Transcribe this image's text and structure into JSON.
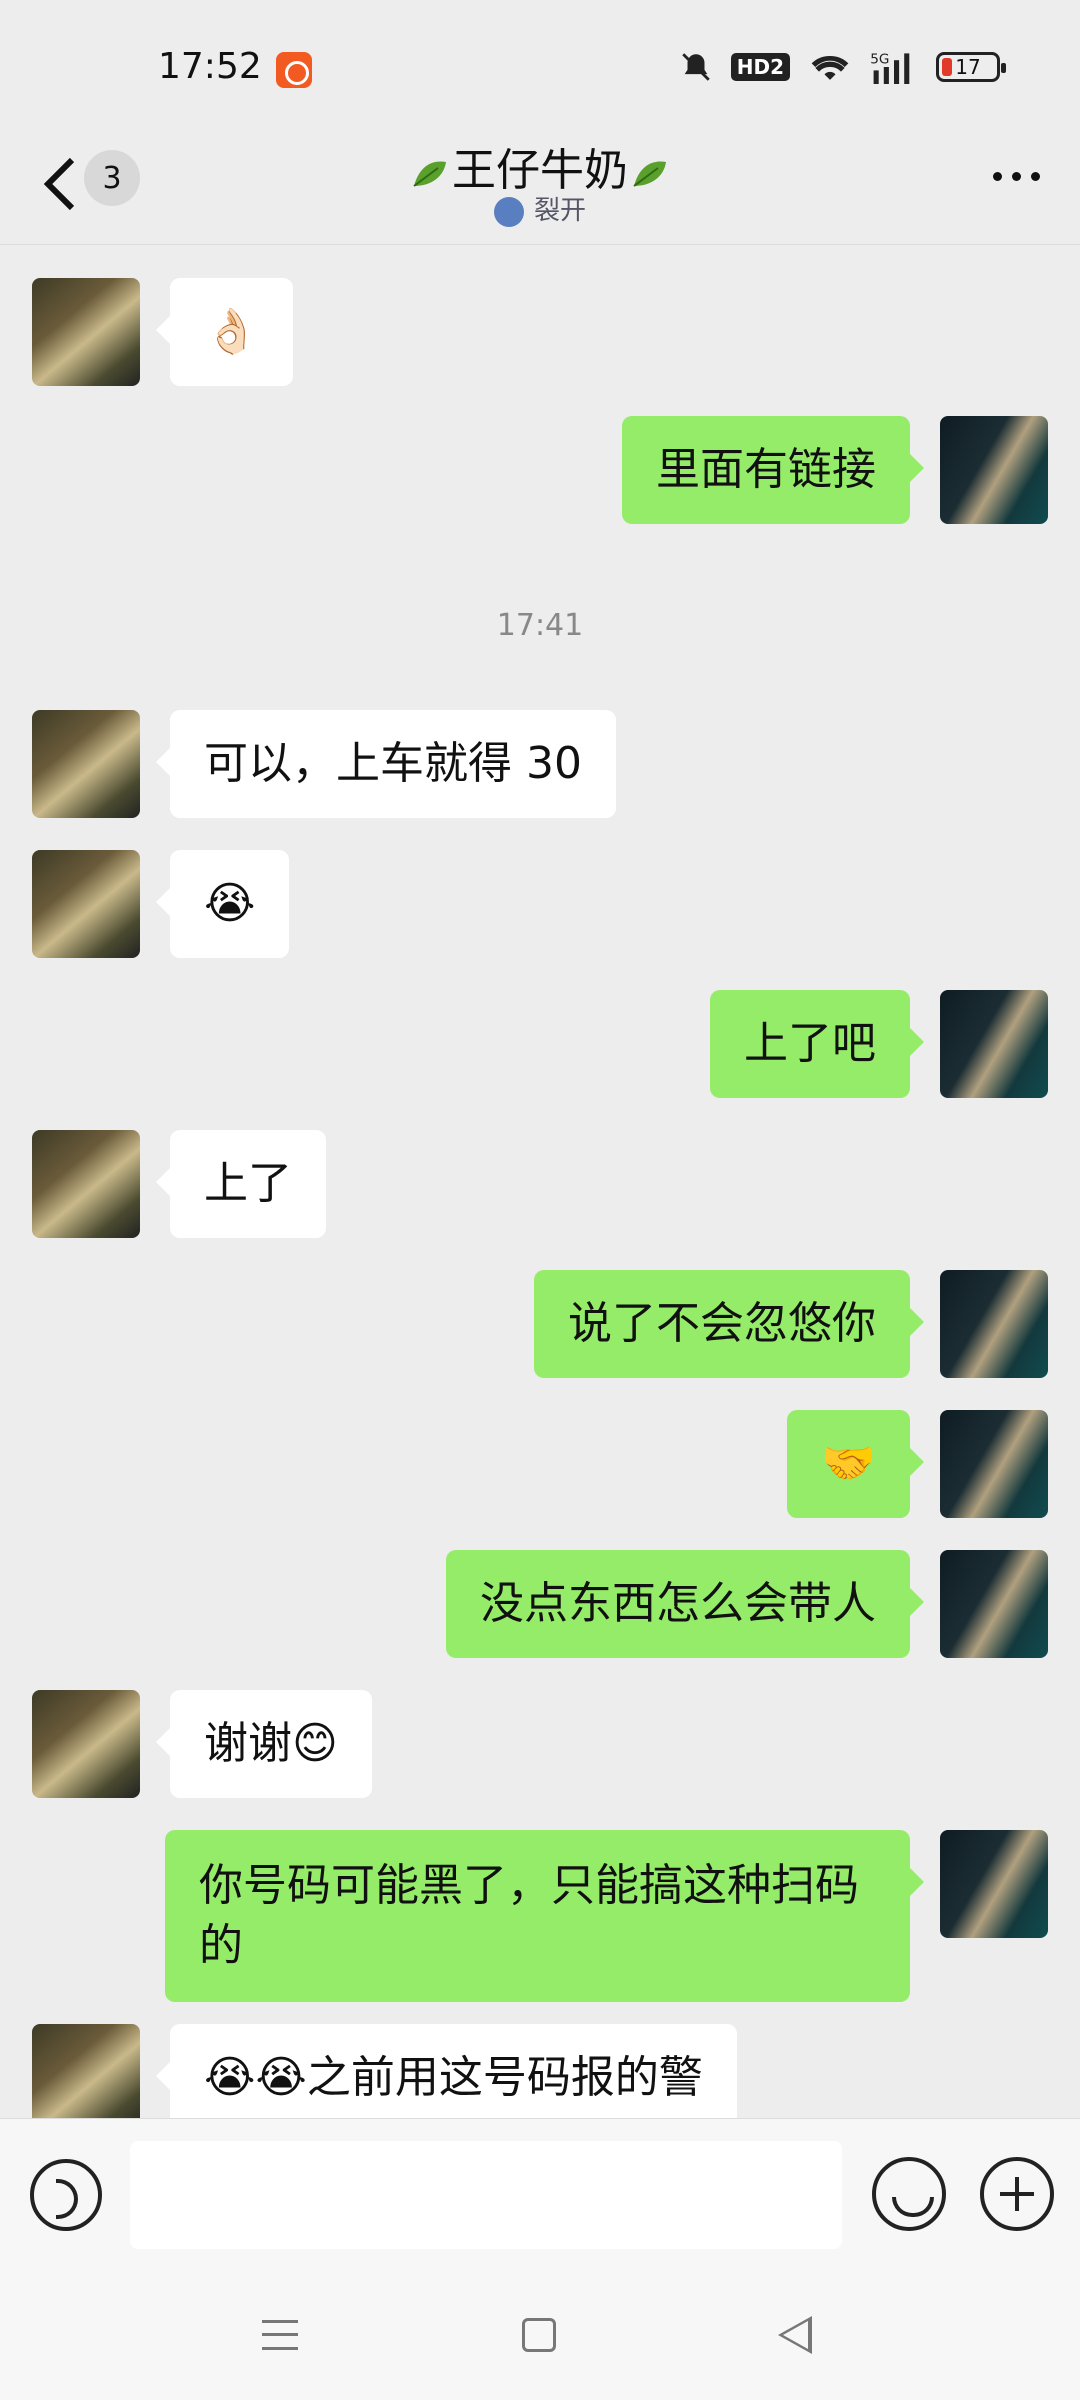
{
  "status": {
    "time": "17:52",
    "battery": "17",
    "hd": "HD2"
  },
  "header": {
    "unread_count": "3",
    "title": "王仔牛奶",
    "subtitle": "裂开"
  },
  "messages": [
    {
      "side": "in",
      "text": "👌🏻"
    },
    {
      "side": "out",
      "text": "里面有链接"
    },
    {
      "timestamp": "17:41"
    },
    {
      "side": "in",
      "text": "可以，上车就得 30"
    },
    {
      "side": "in",
      "text": "😭"
    },
    {
      "side": "out",
      "text": "上了吧"
    },
    {
      "side": "in",
      "text": "上了"
    },
    {
      "side": "out",
      "text": "说了不会忽悠你"
    },
    {
      "side": "out",
      "text": "🤝"
    },
    {
      "side": "out",
      "text": "没点东西怎么会带人"
    },
    {
      "side": "in",
      "text": "谢谢😊"
    },
    {
      "side": "out",
      "text": "你号码可能黑了，只能搞这种扫码的"
    },
    {
      "side": "in",
      "text": "😭😭之前用这号码报的警"
    }
  ]
}
